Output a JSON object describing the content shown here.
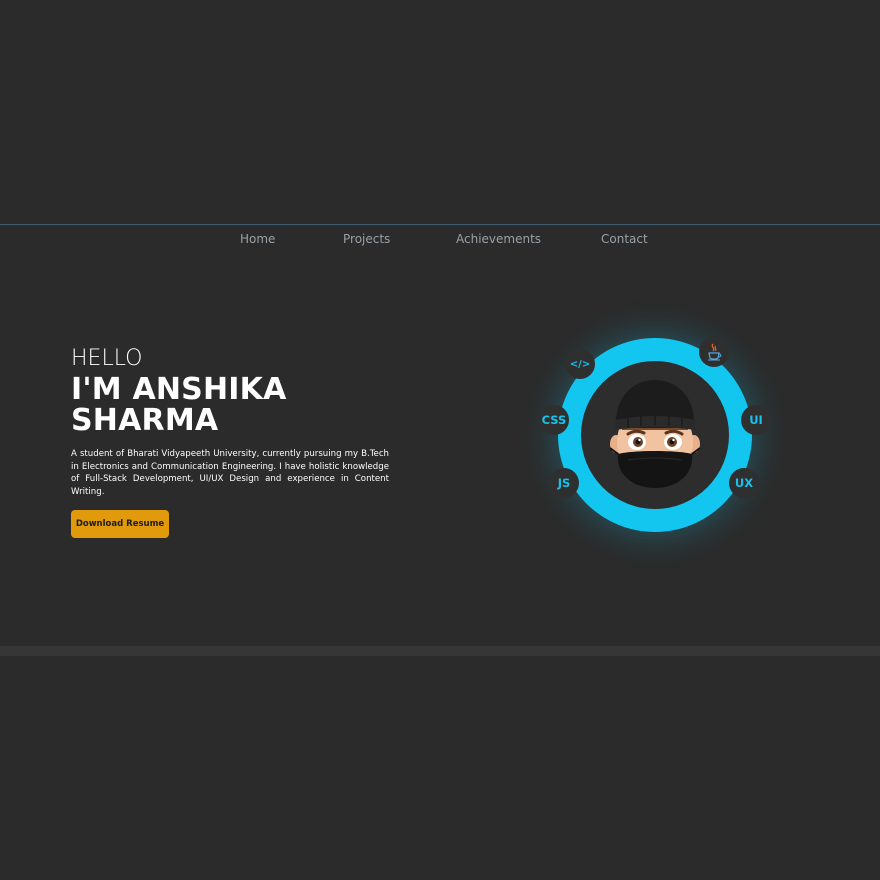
{
  "nav": {
    "items": [
      {
        "label": "Home"
      },
      {
        "label": "Projects"
      },
      {
        "label": "Achievements"
      },
      {
        "label": "Contact"
      }
    ]
  },
  "hero": {
    "greeting": "HELLO",
    "name_line1": "I'M ANSHIKA",
    "name_line2": "SHARMA",
    "intro": "A student of Bharati Vidyapeeth University, currently pursuing my B.Tech in Electronics and Communication Engineering. I have holistic knowledge of Full-Stack Development, UI/UX Design and experience in Content Writing.",
    "cta_label": "Download Resume"
  },
  "skills": {
    "code": "</>",
    "css": "CSS",
    "js": "JS",
    "ui": "UI",
    "ux": "UX",
    "java_icon": "java-icon"
  },
  "colors": {
    "background": "#2b2b2b",
    "accent": "#12c6f0",
    "button": "#e09a0b"
  }
}
